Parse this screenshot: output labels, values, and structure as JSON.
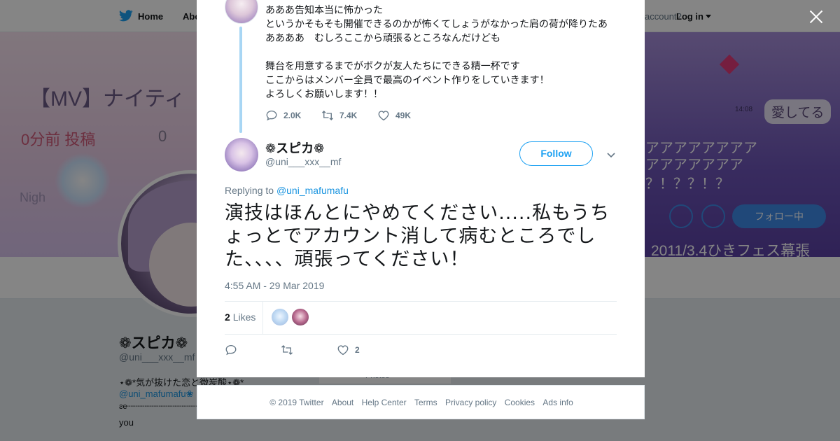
{
  "nav": {
    "home_label": "Home",
    "about_label": "Abo",
    "account_prompt": "account?",
    "login_label": "Log in"
  },
  "banner": {
    "title": "【MV】ナイティ",
    "posted": "0分前 投稿",
    "posted_count": "0",
    "night_text": "Nigh",
    "right_bubble": "愛してる",
    "right_time": "14:08",
    "right_aaa": "アアアアアアアア\nアアアアアアア",
    "right_qqq": "？！？？！？",
    "right_follow": "フォロー中",
    "right_bottom": "2011/3.4ひきフェス幕張"
  },
  "profile": {
    "name": "❁スピカ❁",
    "handle": "@uni___xxx__mf",
    "bio_line1": "⋆❁*気が抜けた恋と微炭酸⋆❁*",
    "bio_line2": "@uni_mafumafu❀",
    "bio_line3": "ƨe┈┈┈┈┈┈┈┈┈┈┈┈┈┈┈┈",
    "bio_line4": "you",
    "photos_label": "Photos"
  },
  "parent_tweet": {
    "lines": [
      "あああ告知本当に怖かった",
      "というかそもそも開催できるのかが怖くてしょうがなかった肩の荷が降りたあ",
      "ああああ　むしろここから頑張るところなんだけども",
      "",
      "舞台を用意するまでがボクが友人たちにできる精一杯です",
      "ここからはメンバー全員で最高のイベント作りをしていきます！",
      "よろしくお願いします！！"
    ],
    "reply_count": "2.0K",
    "retweet_count": "7.4K",
    "like_count": "49K"
  },
  "tweet": {
    "display_name": "❁スピカ❁",
    "handle": "@uni___xxx__mf",
    "follow_label": "Follow",
    "replying_prefix": "Replying to ",
    "replying_to": "@uni_mafumafu",
    "text": "演技はほんとにやめてください.....私もうちょっとでアカウント消して病むところでした、、、、頑張ってください！",
    "timestamp": "4:55 AM - 29 Mar 2019",
    "likes_number": "2",
    "likes_word": "Likes",
    "like_count": "2"
  },
  "footer": {
    "copyright": "© 2019 Twitter",
    "links": [
      "About",
      "Help Center",
      "Terms",
      "Privacy policy",
      "Cookies",
      "Ads info"
    ]
  },
  "colors": {
    "accent": "#1da1f2",
    "link": "#1b95e0",
    "thread_line": "#a8d6f4",
    "muted_text": "#657786"
  },
  "icons": {
    "close": "close-icon",
    "reply": "reply-icon",
    "retweet": "retweet-icon",
    "like": "heart-icon",
    "caret": "chevron-down-icon",
    "logo": "twitter-bird-icon"
  }
}
